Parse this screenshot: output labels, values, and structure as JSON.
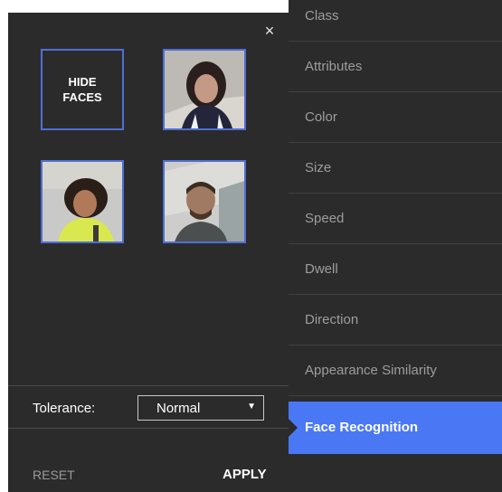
{
  "panel": {
    "close_glyph": "×",
    "hide_faces_label": "HIDE FACES",
    "tolerance_label": "Tolerance:",
    "tolerance_value": "Normal",
    "reset_label": "RESET",
    "apply_label": "APPLY"
  },
  "faces": [
    {
      "name": "face-thumbnail-woman-dark-hair"
    },
    {
      "name": "face-thumbnail-woman-yellow-shirt"
    },
    {
      "name": "face-thumbnail-man-backpack"
    }
  ],
  "menu": {
    "items": [
      {
        "label": "Class"
      },
      {
        "label": "Attributes"
      },
      {
        "label": "Color"
      },
      {
        "label": "Size"
      },
      {
        "label": "Speed"
      },
      {
        "label": "Dwell"
      },
      {
        "label": "Direction"
      },
      {
        "label": "Appearance Similarity"
      },
      {
        "label": "Face Recognition",
        "active": true
      }
    ],
    "active_color": "#4a78f5"
  }
}
